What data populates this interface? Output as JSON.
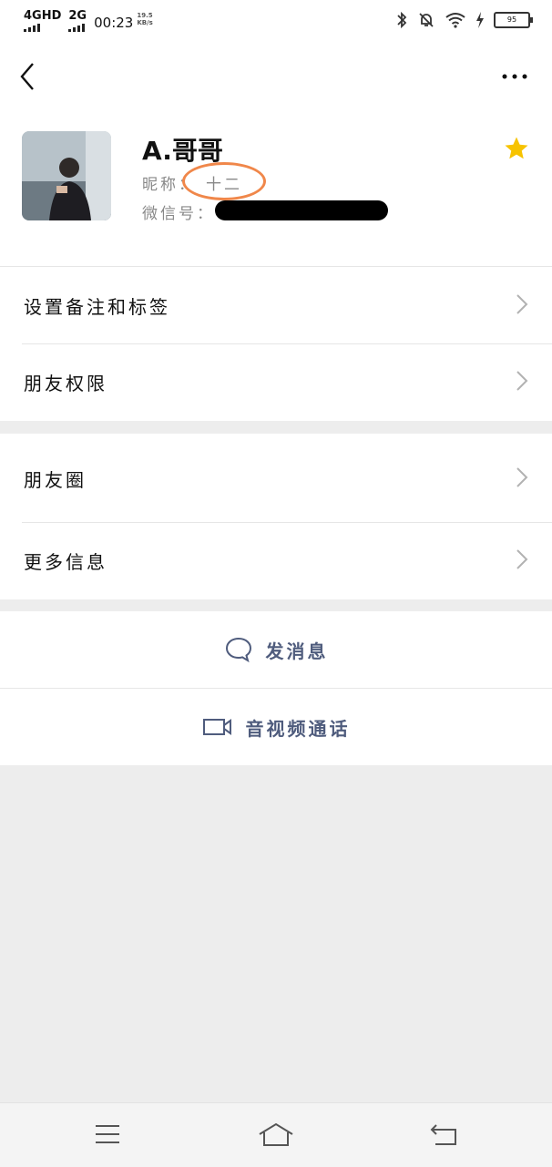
{
  "status_bar": {
    "net1": "4GHD",
    "net2": "2G",
    "time": "00:23",
    "speed_value": "19.5",
    "speed_unit": "KB/s",
    "battery": "95"
  },
  "profile": {
    "name": "A.哥哥",
    "nickname_label": "昵称：",
    "nickname_value": "十二",
    "wechat_id_label": "微信号："
  },
  "menu_section_1": [
    {
      "label": "设置备注和标签"
    },
    {
      "label": "朋友权限"
    }
  ],
  "menu_section_2": [
    {
      "label": "朋友圈"
    },
    {
      "label": "更多信息"
    }
  ],
  "actions": {
    "message_label": "发消息",
    "call_label": "音视频通话"
  },
  "colors": {
    "action_text": "#4f5c7d",
    "star": "#f7c300",
    "annotation_circle": "#f0874a"
  }
}
